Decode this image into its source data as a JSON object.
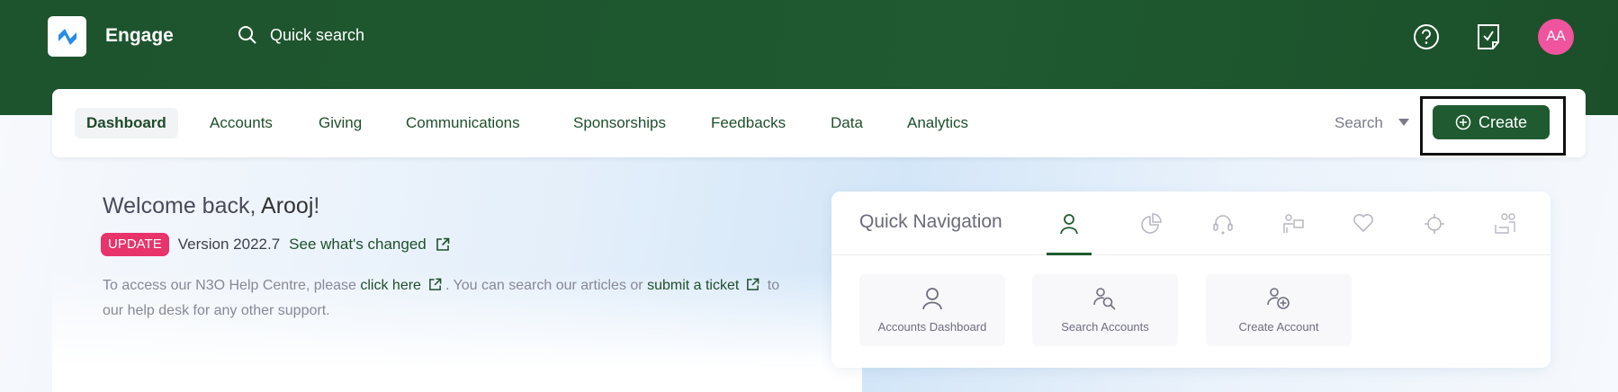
{
  "header": {
    "brand": "Engage",
    "quick_search": "Quick search",
    "avatar_initials": "AA"
  },
  "nav": {
    "items": [
      "Dashboard",
      "Accounts",
      "Giving",
      "Communications",
      "Sponsorships",
      "Feedbacks",
      "Data",
      "Analytics"
    ],
    "search_label": "Search",
    "create_label": "Create"
  },
  "welcome": {
    "greeting": "Welcome back, ",
    "name": "Arooj",
    "exclaim": "!",
    "badge": "UPDATE",
    "version": "Version 2022.7",
    "changes_link": "See what's changed",
    "help_1": "To access our N3O Help Centre, please ",
    "help_link": "click here",
    "help_2": ". You can search our articles or ",
    "ticket_link": "submit a ticket",
    "help_3": " to our help desk for any other support."
  },
  "quick_nav": {
    "title": "Quick Navigation",
    "tabs": [
      "user-icon",
      "pie-chart-icon",
      "headset-icon",
      "person-chat-icon",
      "heart-icon",
      "crosshair-icon",
      "people-desk-icon"
    ],
    "cards": [
      "Accounts Dashboard",
      "Search Accounts",
      "Create Account"
    ]
  },
  "colors": {
    "brand_green": "#1f5a30",
    "badge_pink": "#e8336b",
    "avatar_pink": "#f0549e"
  }
}
